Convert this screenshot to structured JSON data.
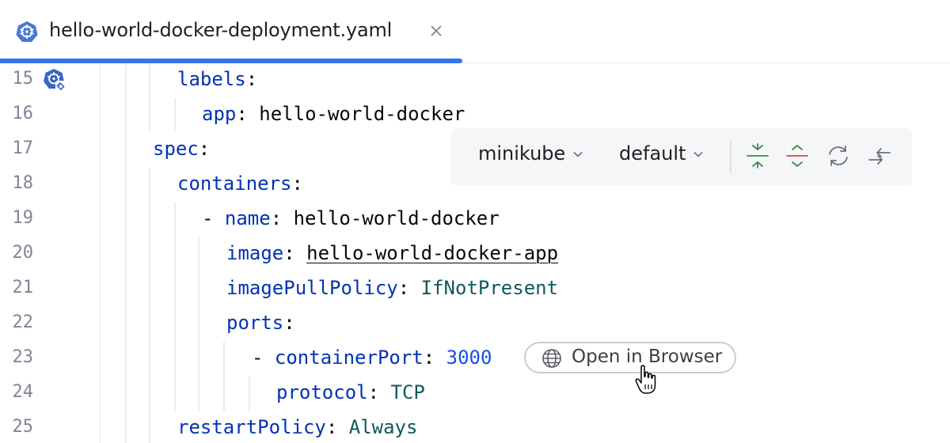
{
  "tab": {
    "title": "hello-world-docker-deployment.yaml",
    "icon": "kubernetes-icon",
    "close_icon": "close-icon"
  },
  "line_numbers": [
    "15",
    "16",
    "17",
    "18",
    "19",
    "20",
    "21",
    "22",
    "23",
    "24",
    "25"
  ],
  "code": {
    "l15": {
      "key": "labels",
      "colon": ":"
    },
    "l16": {
      "key": "app",
      "colon": ":",
      "value": "hello-world-docker"
    },
    "l17": {
      "key": "spec",
      "colon": ":"
    },
    "l18": {
      "key": "containers",
      "colon": ":"
    },
    "l19": {
      "dash": "- ",
      "key": "name",
      "colon": ":",
      "value": "hello-world-docker"
    },
    "l20": {
      "key": "image",
      "colon": ":",
      "value": "hello-world-docker-app"
    },
    "l21": {
      "key": "imagePullPolicy",
      "colon": ":",
      "value": "IfNotPresent"
    },
    "l22": {
      "key": "ports",
      "colon": ":"
    },
    "l23": {
      "dash": "- ",
      "key": "containerPort",
      "colon": ":",
      "value": "3000"
    },
    "l24": {
      "key": "protocol",
      "colon": ":",
      "value": "TCP"
    },
    "l25": {
      "key": "restartPolicy",
      "colon": ":",
      "value": "Always"
    }
  },
  "toolbar": {
    "cluster": "minikube",
    "namespace": "default",
    "buttons": [
      "apply-icon",
      "delete-icon",
      "reload-icon",
      "collapse-icon"
    ]
  },
  "inlay": {
    "label": "Open in Browser",
    "icon": "globe-icon"
  },
  "colors": {
    "accent": "#3574f0",
    "key": "#0033b3",
    "enum_value": "#0e5a5a",
    "number": "#1750eb",
    "apply_green": "#3d8a4a",
    "delete_red": "#d04a4a"
  }
}
